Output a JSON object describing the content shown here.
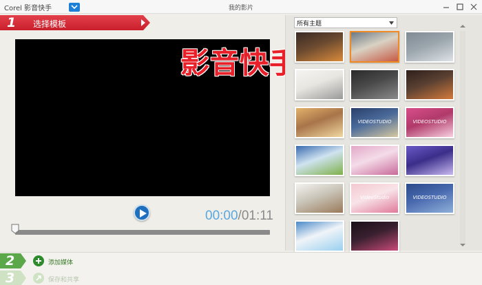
{
  "titlebar": {
    "app_title": "Corel 影音快手",
    "window_title": "我的影片"
  },
  "step1": {
    "number": "1",
    "label": "选择模板"
  },
  "preview": {
    "watermark": "影音快手",
    "timecode_current": "00:00",
    "timecode_separator": "/",
    "timecode_total": "01:11",
    "progress": 0
  },
  "theme_panel": {
    "selected_theme": "所有主题",
    "thumbnails": [
      {
        "id": "t1",
        "text": "",
        "colors": [
          "#3a2a24",
          "#d98a3a",
          "#6b4a30"
        ]
      },
      {
        "id": "t2",
        "text": "",
        "colors": [
          "#6b7a86",
          "#c65a44",
          "#d9d2c4"
        ],
        "selected": true
      },
      {
        "id": "t3",
        "text": "",
        "colors": [
          "#7f8a93",
          "#dde2e6",
          "#9ba5ac"
        ]
      },
      {
        "id": "t4",
        "text": "",
        "colors": [
          "#f4f4f2",
          "#9a9a9a",
          "#e8e6e0"
        ]
      },
      {
        "id": "t5",
        "text": "",
        "colors": [
          "#2a2a2a",
          "#8a8a8a",
          "#4a4a4a"
        ]
      },
      {
        "id": "t6",
        "text": "",
        "colors": [
          "#2e1f1a",
          "#d47a3a",
          "#5a4032"
        ]
      },
      {
        "id": "t7",
        "text": "",
        "colors": [
          "#e3b26a",
          "#f0d8a0",
          "#a8744a"
        ]
      },
      {
        "id": "t8",
        "text": "VIDEOSTUDIO",
        "colors": [
          "#2a3f6a",
          "#d7c9a0",
          "#4a6a9a"
        ]
      },
      {
        "id": "t9",
        "text": "VIDEOSTUDIO",
        "colors": [
          "#d94e8a",
          "#f7d0e0",
          "#b03a6a"
        ]
      },
      {
        "id": "t10",
        "text": "",
        "colors": [
          "#3a6ab0",
          "#7fb04a",
          "#cfe3f0"
        ]
      },
      {
        "id": "t11",
        "text": "",
        "colors": [
          "#e3a8c8",
          "#c86a9a",
          "#f4dce8"
        ]
      },
      {
        "id": "t12",
        "text": "",
        "colors": [
          "#6a5ac8",
          "#c8b8f0",
          "#3a2e8a"
        ]
      },
      {
        "id": "t13",
        "text": "",
        "colors": [
          "#f2f2ee",
          "#9a7a5a",
          "#c9c4b8"
        ]
      },
      {
        "id": "t14",
        "text": "VideoStudio",
        "colors": [
          "#f4c8d0",
          "#e07a9a",
          "#f8e4e8"
        ]
      },
      {
        "id": "t15",
        "text": "VIDEOSTUDIO",
        "colors": [
          "#2a4a8a",
          "#8fb0d8",
          "#4a6ab0"
        ]
      },
      {
        "id": "t16",
        "text": "",
        "colors": [
          "#4a8ac8",
          "#9ad0f0",
          "#f0f4f8"
        ]
      },
      {
        "id": "t17",
        "text": "",
        "colors": [
          "#1a1018",
          "#c84a7a",
          "#3a2030"
        ]
      }
    ]
  },
  "steps": [
    {
      "number": "2",
      "label": "添加媒体",
      "color": "#5aa84a",
      "enabled": true
    },
    {
      "number": "3",
      "label": "保存和共享",
      "color": "#cfe3c4",
      "enabled": false
    }
  ]
}
